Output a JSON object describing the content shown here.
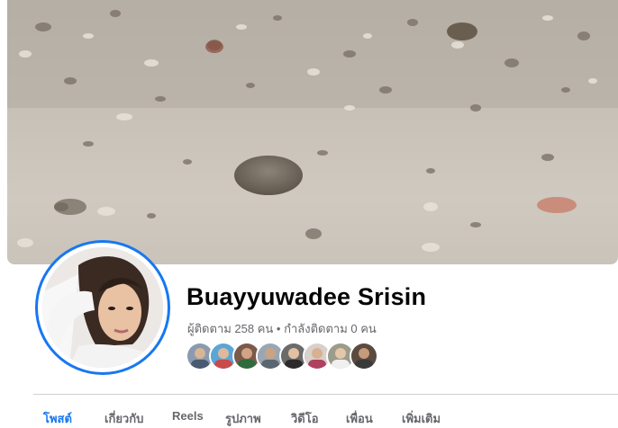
{
  "profile": {
    "name": "Buayyuwadee Srisin",
    "stats": "ผู้ติดตาม 258 คน • กำลังติดตาม 0 คน"
  },
  "followers": [
    {
      "color": "#8a9bb0"
    },
    {
      "color": "#c94a4a"
    },
    {
      "color": "#7a5a4a"
    },
    {
      "color": "#9aa7b3"
    },
    {
      "color": "#6b6b6b"
    },
    {
      "color": "#b04060"
    },
    {
      "color": "#9c9c8c"
    },
    {
      "color": "#5a4a40"
    }
  ],
  "tabs": [
    {
      "label": "โพสต์",
      "active": true
    },
    {
      "label": "เกี่ยวกับ"
    },
    {
      "label": "Reels"
    },
    {
      "label": "รูปภาพ"
    },
    {
      "label": "วิดีโอ"
    },
    {
      "label": "เพื่อน"
    },
    {
      "label": "เพิ่มเติม"
    }
  ],
  "colors": {
    "accent": "#1877f2",
    "secondary_text": "#65676b"
  }
}
